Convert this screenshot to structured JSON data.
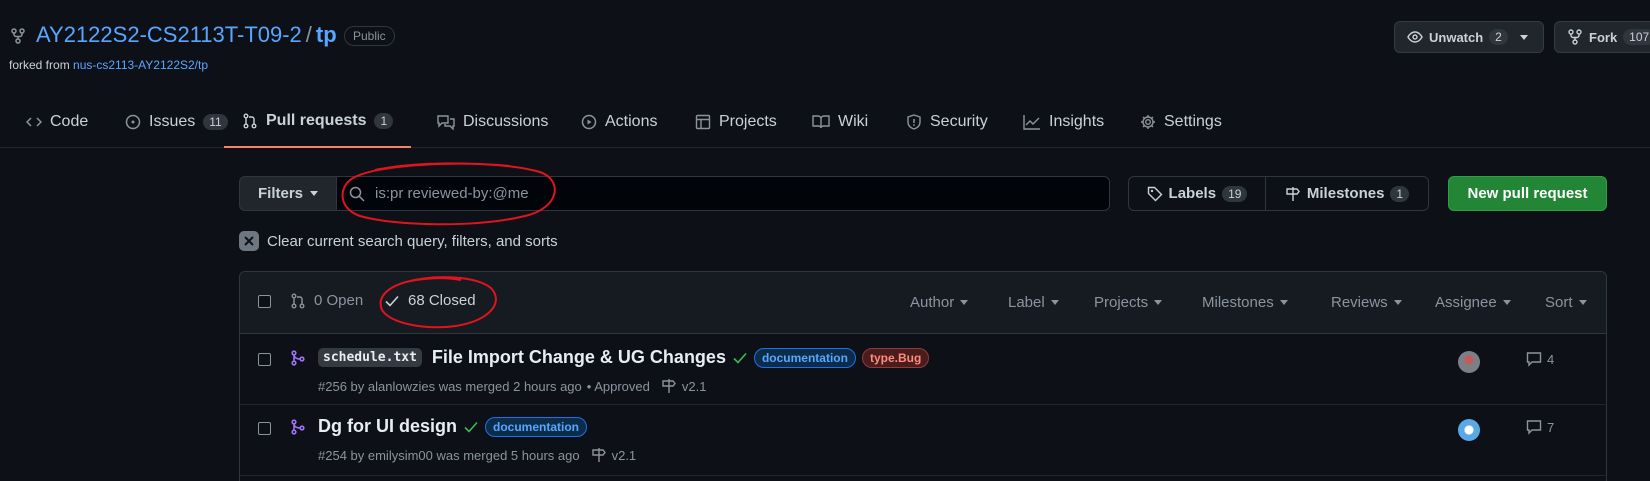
{
  "header": {
    "owner": "AY2122S2-CS2113T-T09-2",
    "separator": "/",
    "repo": "tp",
    "visibility": "Public",
    "forked_prefix": "forked from",
    "forked_source": "nus-cs2113-AY2122S2/tp",
    "unwatch_label": "Unwatch",
    "unwatch_count": "2",
    "fork_label": "Fork",
    "fork_count": "107"
  },
  "nav": [
    {
      "label": "Code",
      "icon": "code-icon"
    },
    {
      "label": "Issues",
      "icon": "issue-icon",
      "count": "11"
    },
    {
      "label": "Pull requests",
      "icon": "pull-request-icon",
      "count": "1",
      "active": true
    },
    {
      "label": "Discussions",
      "icon": "discussions-icon"
    },
    {
      "label": "Actions",
      "icon": "play-icon"
    },
    {
      "label": "Projects",
      "icon": "table-icon"
    },
    {
      "label": "Wiki",
      "icon": "book-icon"
    },
    {
      "label": "Security",
      "icon": "shield-icon"
    },
    {
      "label": "Insights",
      "icon": "graph-icon"
    },
    {
      "label": "Settings",
      "icon": "gear-icon"
    }
  ],
  "filters": {
    "filters_label": "Filters",
    "search_value": "is:pr reviewed-by:@me",
    "labels_label": "Labels",
    "labels_count": "19",
    "milestones_label": "Milestones",
    "milestones_count": "1",
    "new_pr_label": "New pull request",
    "clear_text": "Clear current search query, filters, and sorts"
  },
  "list_header": {
    "open_label": "0 Open",
    "closed_label": "68 Closed",
    "dropdowns": [
      "Author",
      "Label",
      "Projects",
      "Milestones",
      "Reviews",
      "Assignee",
      "Sort"
    ]
  },
  "pull_requests": [
    {
      "code": "schedule.txt",
      "title": "File Import Change & UG Changes",
      "labels": [
        {
          "text": "documentation",
          "color": "#58a6ff",
          "bg": "#0c2d4a",
          "border": "#1f6feb"
        },
        {
          "text": "type.Bug",
          "color": "#ff8a80",
          "bg": "#4a1c1c",
          "border": "#8e3b3b"
        }
      ],
      "meta": "#256 by alanlowzies was merged 2 hours ago",
      "review": "• Approved",
      "milestone": "v2.1",
      "comments": "4"
    },
    {
      "code": "",
      "title": "Dg for UI design",
      "labels": [
        {
          "text": "documentation",
          "color": "#58a6ff",
          "bg": "#0c2d4a",
          "border": "#1f6feb"
        }
      ],
      "meta": "#254 by emilysim00 was merged 5 hours ago",
      "review": "",
      "milestone": "v2.1",
      "comments": "7"
    }
  ],
  "colors": {
    "accent": "#58a6ff",
    "merged": "#a371f7",
    "success": "#3fb950",
    "annotation": "#e0141e",
    "active_tab": "#f78166"
  }
}
